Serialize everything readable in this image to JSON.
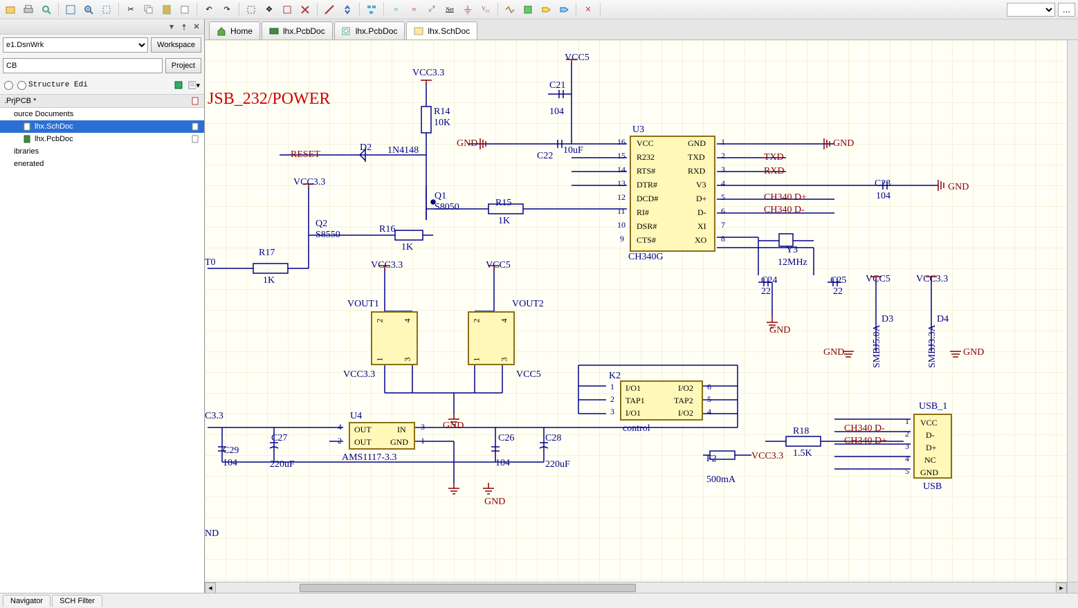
{
  "toolbar": {
    "combo_placeholder": "",
    "ellipsis": "..."
  },
  "left_panel": {
    "workspace_select": "e1.DsnWrk",
    "workspace_btn": "Workspace",
    "project_input": "CB",
    "project_btn": "Project",
    "structure_radio": "Structure Edi",
    "header": ".PrjPCB *",
    "items": [
      "ource Documents",
      "lhx.SchDoc",
      "lhx.PcbDoc",
      "ibraries",
      "enerated"
    ]
  },
  "tabs": [
    "Home",
    "lhx.PcbDoc",
    "lhx.PcbDoc",
    "lhx.SchDoc"
  ],
  "bottom_tabs": [
    "Navigator",
    "SCH Filter"
  ],
  "schematic": {
    "title": "JSB_232/POWER",
    "labels": {
      "reset": "RESET",
      "vcc33_1": "VCC3.3",
      "vcc33_2": "VCC3.3",
      "vcc33_3": "VCC3.3",
      "vcc33_4": "VCC3.3",
      "vcc33_5": "VCC3.3",
      "vcc33_6": "VCC3.3",
      "vcc33_7": "C3.3",
      "vcc5_1": "VCC5",
      "vcc5_2": "VCC5",
      "vcc5_3": "VCC5",
      "vcc5_4": "VCC5",
      "gnd_1": "GND",
      "gnd_2": "GND",
      "gnd_3": "GND",
      "gnd_4": "GND",
      "gnd_5": "GND",
      "gnd_6": "GND",
      "gnd_7": "GND",
      "gnd_8": "GND",
      "gnd_9": "ND",
      "t0": "T0",
      "d2": "D2",
      "d2v": "1N4148",
      "r14": "R14",
      "r14v": "10K",
      "r15": "R15",
      "r15v": "1K",
      "r16": "R16",
      "r16v": "1K",
      "r17": "R17",
      "r17v": "1K",
      "r18": "R18",
      "r18v": "1.5K",
      "q1": "Q1",
      "q1v": "S8050",
      "q2": "Q2",
      "q2v": "S8550",
      "c21": "C21",
      "c21v": "104",
      "c22": "C22",
      "c22v": "10uF",
      "c23": "C23",
      "c23v": "104",
      "c24": "C24",
      "c24v": "22",
      "c25": "C25",
      "c25v": "22",
      "c26": "C26",
      "c26v": "104",
      "c27": "C27",
      "c27v": "220uF",
      "c28": "C28",
      "c28v": "220uF",
      "c29": "C29",
      "c29v": "104",
      "y3": "Y3",
      "y3v": "12MHz",
      "d3": "D3",
      "d3v": "SMBJ5.0A",
      "d4": "D4",
      "d4v": "SMBJ3.3A",
      "f2": "F2",
      "f2v": "500mA",
      "vout1": "VOUT1",
      "vout2": "VOUT2",
      "u3": "U3",
      "u3v": "CH340G",
      "u4": "U4",
      "u4v": "AMS1117-3.3",
      "k2": "K2",
      "k2v": "control",
      "usb1": "USB_1",
      "usb1v": "USB",
      "txd": "TXD",
      "rxd": "RXD",
      "ch340dp": "CH340 D+",
      "ch340dm": "CH340 D-",
      "ch340dm2": "CH340 D-",
      "ch340dp2": "CH340 D+"
    },
    "u3_pins_left_nums": [
      "16",
      "15",
      "14",
      "13",
      "12",
      "11",
      "10",
      "9"
    ],
    "u3_pins_left_names": [
      "VCC",
      "R232",
      "RTS#",
      "DTR#",
      "DCD#",
      "RI#",
      "DSR#",
      "CTS#"
    ],
    "u3_pins_right_nums": [
      "1",
      "2",
      "3",
      "4",
      "5",
      "6",
      "7",
      "8"
    ],
    "u3_pins_right_names": [
      "GND",
      "TXD",
      "RXD",
      "V3",
      "D+",
      "D-",
      "XI",
      "XO"
    ],
    "u4_pins": {
      "out1": "OUT",
      "out2": "OUT",
      "in": "IN",
      "gnd": "GND",
      "n4": "4",
      "n2": "2",
      "n3": "3",
      "n1": "1"
    },
    "k2_pins": {
      "io1a": "I/O1",
      "io2a": "I/O2",
      "tap1": "TAP1",
      "tap2": "TAP2",
      "io1b": "I/O1",
      "io2b": "I/O2",
      "n1": "1",
      "n2": "2",
      "n3": "3",
      "n4": "4",
      "n5": "5",
      "n6": "6"
    },
    "usb_pins": {
      "vcc": "VCC",
      "dm": "D-",
      "dp": "D+",
      "nc": "NC",
      "gnd": "GND",
      "n1": "1",
      "n2": "2",
      "n3": "3",
      "n4": "4",
      "n5": "5"
    },
    "vout_pins": {
      "p1": "1",
      "p2": "2",
      "p3": "3",
      "p4": "4"
    }
  }
}
